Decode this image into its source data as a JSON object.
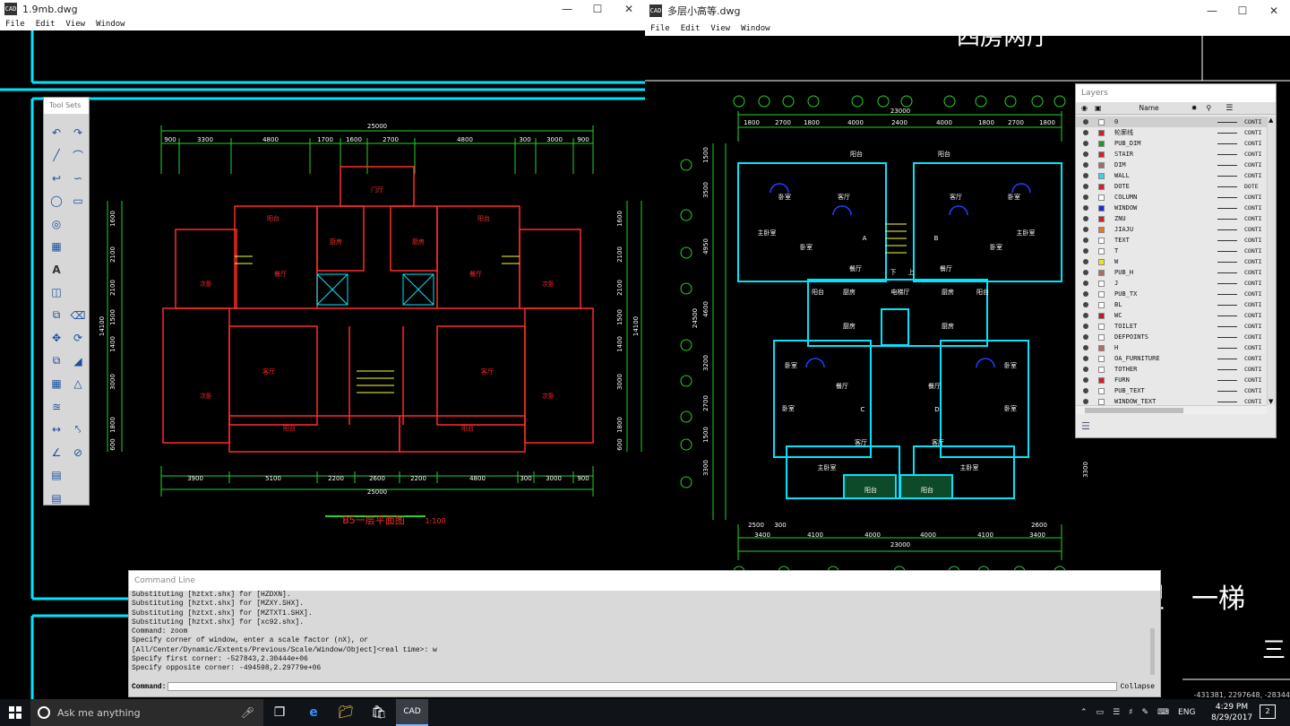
{
  "left_window": {
    "title": "1.9mb.dwg",
    "app_icon": "CAD",
    "menu": [
      "File",
      "Edit",
      "View",
      "Window"
    ],
    "drawing": {
      "top_dims_total": "25000",
      "top_dims": [
        "900",
        "3300",
        "4800",
        "1700",
        "1600",
        "2700",
        "4800",
        "300",
        "3000",
        "900"
      ],
      "bottom_dims": [
        "3900",
        "5100",
        "2200",
        "2600",
        "2200",
        "4800",
        "300",
        "3000",
        "900"
      ],
      "bottom_total": "25000",
      "left_dims": [
        "1600",
        "2100",
        "2100",
        "1500",
        "1400",
        "3000",
        "1800",
        "600"
      ],
      "right_dims": [
        "1600",
        "2100",
        "2100",
        "1500",
        "1400",
        "3000",
        "1800",
        "600"
      ],
      "side_total": "14100",
      "rooms": [
        "门厅",
        "阳台",
        "厨房",
        "厨房",
        "阳台",
        "餐厅",
        "餐厅",
        "次卧",
        "次卧",
        "客厅",
        "客厅",
        "次卧",
        "次卧",
        "阳台",
        "阳台"
      ],
      "title": "B5一层平面图",
      "scale": "1:100"
    }
  },
  "right_window": {
    "title": "多层小高等.dwg",
    "app_icon": "CAD",
    "menu": [
      "File",
      "Edit",
      "View",
      "Window"
    ],
    "drawing": {
      "top_total": "23000",
      "top_dims": [
        "1800",
        "2700",
        "1800",
        "4000",
        "2400",
        "4000",
        "1800",
        "2700",
        "1800"
      ],
      "left_dims": [
        "1500",
        "3500",
        "4950",
        "4600",
        "3200",
        "2700",
        "1500",
        "3300"
      ],
      "left_total": "24500",
      "bottom_dims_1": [
        "2500",
        "300",
        "2600"
      ],
      "bottom_dims_2": [
        "3400",
        "4100",
        "4000",
        "4000",
        "4100",
        "3400"
      ],
      "bottom_total": "23000",
      "rooms": [
        "阳台",
        "阳台",
        "卧室",
        "客厅",
        "客厅",
        "卧室",
        "主卧室",
        "主卧室",
        "卧室",
        "卧室",
        "餐厅",
        "餐厅",
        "阳台",
        "厨房",
        "电梯厅",
        "厨房",
        "阳台",
        "厨房",
        "厨房",
        "卧室",
        "卧室",
        "餐厅",
        "餐厅",
        "卧室",
        "卧室",
        "客厅",
        "客厅",
        "主卧室",
        "主卧室",
        "阳台",
        "阳台"
      ],
      "heading_partial": "四房两厅",
      "side_text_partial": "型　一梯",
      "side_text_partial2": "三",
      "coords": "-431381, 2297648, -28344",
      "side_dim": "3300",
      "axis_a": "A",
      "axis_b": "B",
      "axis_c": "C",
      "axis_d": "D",
      "up": "上",
      "down": "下"
    }
  },
  "tool_sets": {
    "title": "Tool Sets",
    "tools": [
      "undo-icon",
      "redo-icon",
      "line-icon",
      "arc-icon",
      "polyline-icon",
      "spline-icon",
      "circle-icon",
      "rectangle-icon",
      "ellipse-icon",
      "",
      "hatch-icon",
      "",
      "text-icon",
      "",
      "block-icon",
      "",
      "copy-icon",
      "erase-icon",
      "move-icon",
      "rotate-icon",
      "scale-icon",
      "stretch-icon",
      "array-icon",
      "mirror-icon",
      "offset-icon",
      "",
      "dim-linear-icon",
      "dim-aligned-icon",
      "dim-angular-icon",
      "dim-radius-icon",
      "table-icon",
      "",
      "layout-icon",
      ""
    ]
  },
  "layers_panel": {
    "title": "Layers",
    "col_name": "Name",
    "rows": [
      {
        "name": "0",
        "color": "#ffffff",
        "lw": "CONTI"
      },
      {
        "name": "轮廓线",
        "color": "#d81b2a",
        "lw": "CONTI"
      },
      {
        "name": "PUB_DIM",
        "color": "#1a9a2a",
        "lw": "CONTI"
      },
      {
        "name": "STAIR",
        "color": "#d81b2a",
        "lw": "CONTI"
      },
      {
        "name": "DIM",
        "color": "#9c6b6b",
        "lw": "CONTI"
      },
      {
        "name": "WALL",
        "color": "#35d4e0",
        "lw": "CONTI"
      },
      {
        "name": "DOTE",
        "color": "#d81b2a",
        "lw": "DOTE"
      },
      {
        "name": "COLUMN",
        "color": "#ffffff",
        "lw": "CONTI"
      },
      {
        "name": "WINDOW",
        "color": "#1a2ad8",
        "lw": "CONTI"
      },
      {
        "name": "ZNU",
        "color": "#d81b2a",
        "lw": "CONTI"
      },
      {
        "name": "JIAJU",
        "color": "#e07a1a",
        "lw": "CONTI"
      },
      {
        "name": "TEXT",
        "color": "#ffffff",
        "lw": "CONTI"
      },
      {
        "name": "T",
        "color": "#ffffff",
        "lw": "CONTI"
      },
      {
        "name": "W",
        "color": "#e8e81a",
        "lw": "CONTI"
      },
      {
        "name": "PUB_H",
        "color": "#b06a6a",
        "lw": "CONTI"
      },
      {
        "name": "J",
        "color": "#ffffff",
        "lw": "CONTI"
      },
      {
        "name": "PUB_TX",
        "color": "#ffffff",
        "lw": "CONTI"
      },
      {
        "name": "BL",
        "color": "#ffffff",
        "lw": "CONTI"
      },
      {
        "name": "WC",
        "color": "#c01a2a",
        "lw": "CONTI"
      },
      {
        "name": "TOILET",
        "color": "#ffffff",
        "lw": "CONTI"
      },
      {
        "name": "DEFPOINTS",
        "color": "#ffffff",
        "lw": "CONTI"
      },
      {
        "name": "H",
        "color": "#b06a6a",
        "lw": "CONTI"
      },
      {
        "name": "OA_FURNITURE",
        "color": "#ffffff",
        "lw": "CONTI"
      },
      {
        "name": "TOTHER",
        "color": "#ffffff",
        "lw": "CONTI"
      },
      {
        "name": "FURN",
        "color": "#d81b2a",
        "lw": "CONTI"
      },
      {
        "name": "PUB_TEXT",
        "color": "#ffffff",
        "lw": "CONTI"
      },
      {
        "name": "WINDOW_TEXT",
        "color": "#ffffff",
        "lw": "CONTI"
      }
    ]
  },
  "command_line": {
    "title": "Command Line",
    "history": [
      "Substituting [hztxt.shx] for [HZDXN].",
      "Substituting [hztxt.shx] for [MZXY.SHX].",
      "Substituting [hztxt.shx] for [MZTXT1.SHX].",
      "Substituting [hztxt.shx] for [xc92.shx].",
      "Command: zoom",
      "Specify corner of window, enter a scale factor (nX), or",
      "[All/Center/Dynamic/Extents/Previous/Scale/Window/Object]<real time>: w",
      "Specify first corner: -527843,2.30444e+06",
      "Specify opposite corner: -494598,2.29779e+06"
    ],
    "prompt": "Command:",
    "input_value": "",
    "collapse_label": "Collapse"
  },
  "taskbar": {
    "search_placeholder": "Ask me anything",
    "lang": "ENG",
    "time": "4:29 PM",
    "date": "8/29/2017",
    "notification_count": "2"
  },
  "colors": {
    "cyan": "#00e5ff",
    "red": "#ff2a2a",
    "green": "#22d32a",
    "white": "#ffffff",
    "yellow": "#ffff33",
    "blue": "#2a3aff"
  }
}
